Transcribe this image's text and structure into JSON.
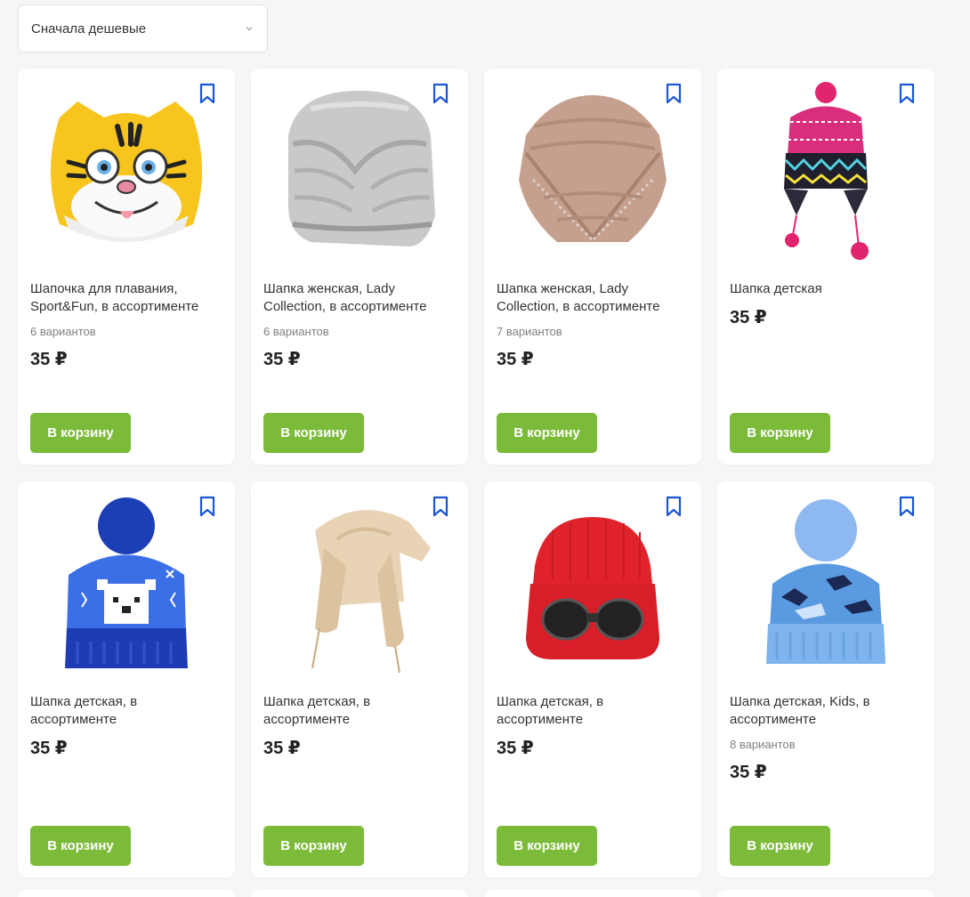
{
  "sort": {
    "selected": "Сначала дешевые"
  },
  "products": [
    {
      "title": "Шапочка для плавания, Sport&Fun, в ассортименте",
      "variants": "6 вариантов",
      "price": "35 ₽",
      "button": "В корзину",
      "image": "tiger-swim-cap"
    },
    {
      "title": "Шапка женская, Lady Collection, в ассортименте",
      "variants": "6 вариантов",
      "price": "35 ₽",
      "button": "В корзину",
      "image": "grey-turban-hat"
    },
    {
      "title": "Шапка женская, Lady Collection, в ассортименте",
      "variants": "7 вариантов",
      "price": "35 ₽",
      "button": "В корзину",
      "image": "beige-turban-hat"
    },
    {
      "title": "Шапка детская",
      "variants": "",
      "price": "35 ₽",
      "button": "В корзину",
      "image": "knit-earflap-hat"
    },
    {
      "title": "Шапка детская, в ассортименте",
      "variants": "",
      "price": "35 ₽",
      "button": "В корзину",
      "image": "polar-bear-beanie"
    },
    {
      "title": "Шапка детская, в ассортименте",
      "variants": "",
      "price": "35 ₽",
      "button": "В корзину",
      "image": "fur-ushanka"
    },
    {
      "title": "Шапка детская, в ассортименте",
      "variants": "",
      "price": "35 ₽",
      "button": "В корзину",
      "image": "red-goggle-beanie"
    },
    {
      "title": "Шапка детская, Kids, в ассортименте",
      "variants": "8 вариантов",
      "price": "35 ₽",
      "button": "В корзину",
      "image": "blue-dino-beanie"
    }
  ],
  "colors": {
    "accent_green": "#7cbb3a",
    "bookmark_blue": "#1a56d6"
  }
}
